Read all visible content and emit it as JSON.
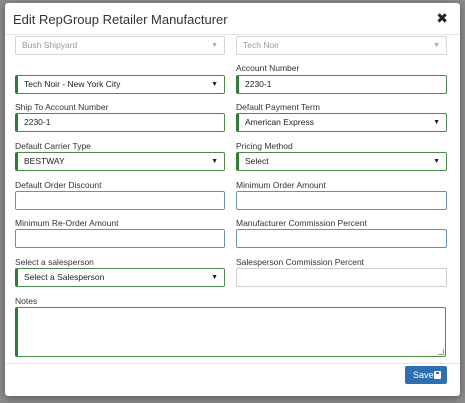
{
  "modal": {
    "title": "Edit RepGroup Retailer Manufacturer",
    "close_symbol": "✖"
  },
  "fields": {
    "shipyard": {
      "value": "Bush Shipyard"
    },
    "manufacturer": {
      "value": "Tech Noir"
    },
    "location": {
      "value": "Tech Noir - New York City"
    },
    "account_number": {
      "label": "Account Number",
      "value": "2230-1"
    },
    "ship_to_account": {
      "label": "Ship To Account Number",
      "value": "2230-1"
    },
    "payment_term": {
      "label": "Default Payment Term",
      "value": "American Express"
    },
    "carrier_type": {
      "label": "Default Carrier Type",
      "value": "BESTWAY"
    },
    "pricing_method": {
      "label": "Pricing Method",
      "value": "Select"
    },
    "order_discount": {
      "label": "Default Order Discount",
      "value": ""
    },
    "min_order_amount": {
      "label": "Minimum Order Amount",
      "value": ""
    },
    "min_reorder_amount": {
      "label": "Minimum Re-Order Amount",
      "value": ""
    },
    "mfr_commission": {
      "label": "Manufacturer Commission Percent",
      "value": ""
    },
    "salesperson": {
      "label": "Select a salesperson",
      "value": "Select a Salesperson"
    },
    "sp_commission": {
      "label": "Salesperson Commission Percent",
      "value": ""
    },
    "notes": {
      "label": "Notes",
      "value": ""
    }
  },
  "footer": {
    "save_label": "Save",
    "save_icon": "floppy-disk-icon"
  },
  "colors": {
    "valid_border": "#2e7d32",
    "save_button": "#2f6fb0"
  },
  "caret_glyph": "▼"
}
